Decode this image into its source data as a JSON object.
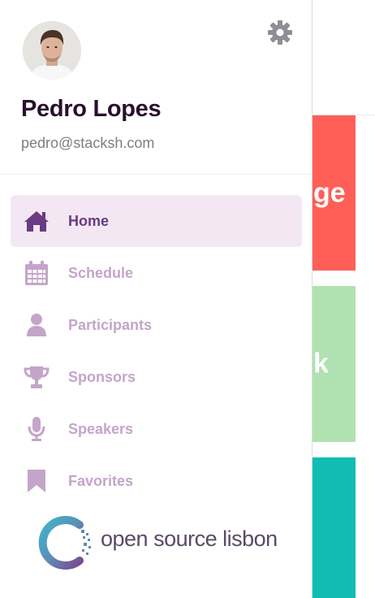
{
  "background": {
    "cards": [
      {
        "text": "ge",
        "color": "#ff5f57"
      },
      {
        "text": "k",
        "color": "#b0e1b0"
      },
      {
        "text": "",
        "color": "#10bcb3"
      }
    ]
  },
  "drawer": {
    "user": {
      "name": "Pedro Lopes",
      "email": "pedro@stacksh.com"
    },
    "settings_icon": "gear-icon",
    "nav": [
      {
        "label": "Home",
        "icon": "home-icon",
        "active": true
      },
      {
        "label": "Schedule",
        "icon": "calendar-icon",
        "active": false
      },
      {
        "label": "Participants",
        "icon": "user-icon",
        "active": false
      },
      {
        "label": "Sponsors",
        "icon": "trophy-icon",
        "active": false
      },
      {
        "label": "Speakers",
        "icon": "microphone-icon",
        "active": false
      },
      {
        "label": "Favorites",
        "icon": "bookmark-icon",
        "active": false
      }
    ],
    "logo_text": "open source lisbon"
  },
  "colors": {
    "active_bg": "#f3e7f4",
    "active_text": "#6a3a82",
    "inactive_text": "#c4a5c9",
    "name": "#2a0f2c"
  }
}
